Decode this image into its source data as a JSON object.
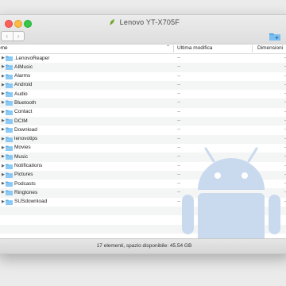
{
  "window": {
    "title": "Lenovo YT-X705F",
    "back_icon": "chevron-left-icon",
    "forward_icon": "chevron-right-icon",
    "new_folder_icon": "new-folder-icon"
  },
  "columns": {
    "name": "ome",
    "modified": "Ultima modifica",
    "size": "Dimensioni"
  },
  "files": [
    {
      "name": ".LenovoReaper",
      "modified": "--",
      "size": "-"
    },
    {
      "name": "AIMusic",
      "modified": "--",
      "size": "-"
    },
    {
      "name": "Alarms",
      "modified": "--",
      "size": "-"
    },
    {
      "name": "Android",
      "modified": "--",
      "size": "-"
    },
    {
      "name": "Audio",
      "modified": "--",
      "size": "-"
    },
    {
      "name": "Bluetooth",
      "modified": "--",
      "size": "-"
    },
    {
      "name": "Contact",
      "modified": "--",
      "size": "-"
    },
    {
      "name": "DCIM",
      "modified": "--",
      "size": "-"
    },
    {
      "name": "Download",
      "modified": "--",
      "size": "-"
    },
    {
      "name": "lenovotips",
      "modified": "--",
      "size": "-"
    },
    {
      "name": "Movies",
      "modified": "--",
      "size": "-"
    },
    {
      "name": "Music",
      "modified": "--",
      "size": "-"
    },
    {
      "name": "Notifications",
      "modified": "--",
      "size": "-"
    },
    {
      "name": "Pictures",
      "modified": "--",
      "size": "-"
    },
    {
      "name": "Podcasts",
      "modified": "--",
      "size": "-"
    },
    {
      "name": "Ringtones",
      "modified": "--",
      "size": "-"
    },
    {
      "name": "SUSdownload",
      "modified": "--",
      "size": "-"
    }
  ],
  "status": "17 elementi, spazio disponibile: 45.54 GB",
  "colors": {
    "folder": "#5bb2ef",
    "android_watermark": "#c9d9ee",
    "title_leaf": "#7cb33b"
  }
}
